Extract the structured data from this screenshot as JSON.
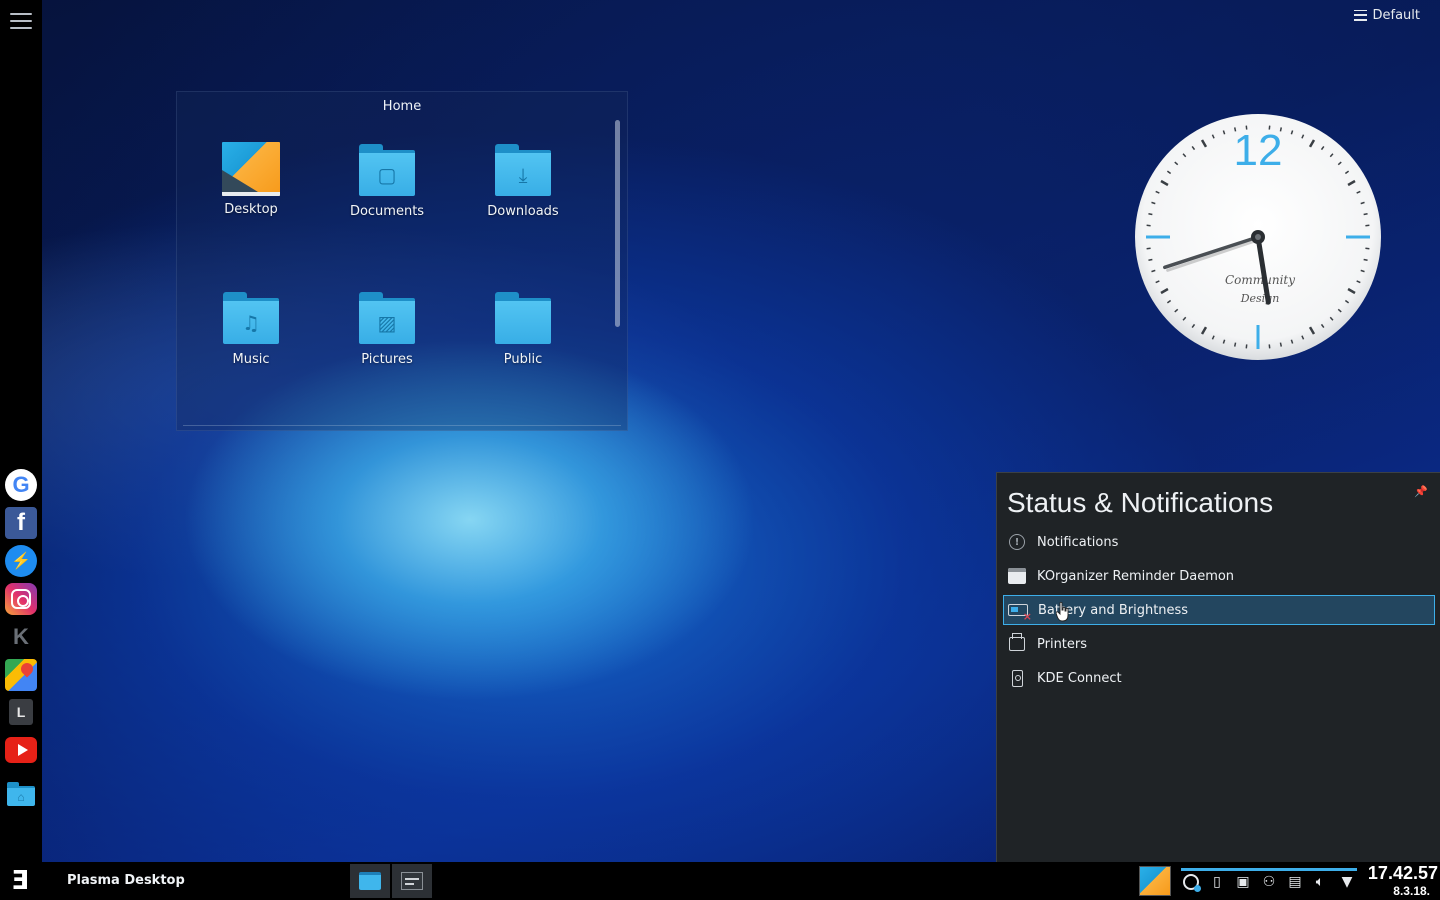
{
  "desktop": {
    "toolbox_label": "Default"
  },
  "folder_view": {
    "title": "Home",
    "items": [
      {
        "label": "Desktop",
        "icon": "desktop-folder-icon"
      },
      {
        "label": "Documents",
        "icon": "documents-folder-icon"
      },
      {
        "label": "Downloads",
        "icon": "downloads-folder-icon"
      },
      {
        "label": "Music",
        "icon": "music-folder-icon"
      },
      {
        "label": "Pictures",
        "icon": "pictures-folder-icon"
      },
      {
        "label": "Public",
        "icon": "public-folder-icon"
      }
    ]
  },
  "clock_widget": {
    "numeral": "12",
    "brand_line1": "Community",
    "brand_line2": "Design",
    "accent": "#3daee9",
    "hour": 5,
    "minute": 42
  },
  "left_dock": {
    "apps": [
      {
        "name": "google",
        "glyph": "G"
      },
      {
        "name": "facebook",
        "glyph": "f"
      },
      {
        "name": "messenger",
        "glyph": "m"
      },
      {
        "name": "instagram",
        "glyph": ""
      },
      {
        "name": "kde",
        "glyph": "K"
      },
      {
        "name": "google-maps",
        "glyph": ""
      },
      {
        "name": "launcher-l",
        "glyph": "L"
      },
      {
        "name": "youtube",
        "glyph": ""
      },
      {
        "name": "home-folder",
        "glyph": "⌂"
      }
    ]
  },
  "status_popup": {
    "title": "Status & Notifications",
    "items": [
      {
        "label": "Notifications",
        "icon": "notifications-icon"
      },
      {
        "label": "KOrganizer Reminder Daemon",
        "icon": "korganizer-icon"
      },
      {
        "label": "Battery and Brightness",
        "icon": "battery-icon",
        "selected": true
      },
      {
        "label": "Printers",
        "icon": "printer-icon"
      },
      {
        "label": "KDE Connect",
        "icon": "kdeconnect-icon"
      }
    ],
    "selection_color": "#3daee9"
  },
  "taskbar": {
    "activity_title": "Plasma Desktop",
    "time": "17.42.57",
    "date": "8.3.18.",
    "tray_icons": [
      "updates-icon",
      "usb-icon",
      "network-icon",
      "user-icon",
      "clipboard-icon",
      "volume-icon",
      "expand-tray-icon"
    ]
  }
}
